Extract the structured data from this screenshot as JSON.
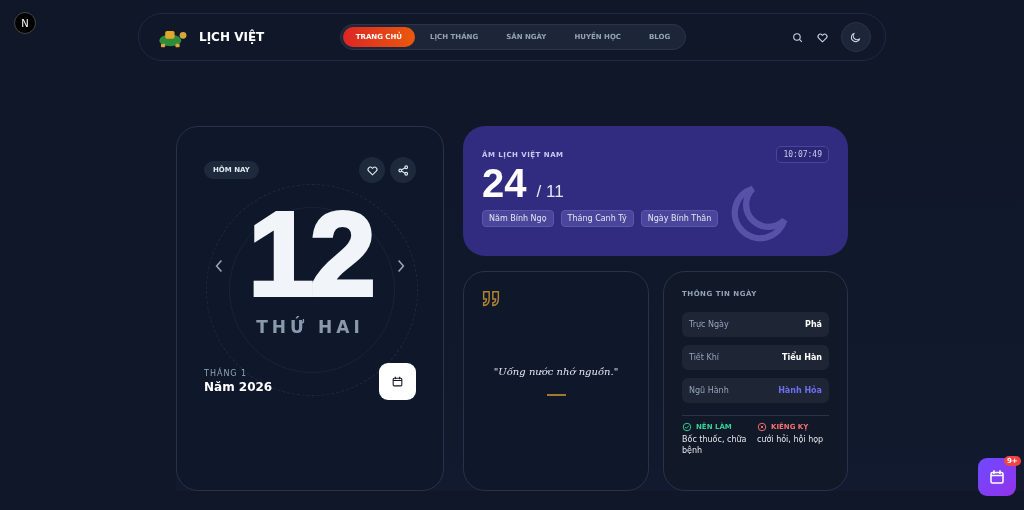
{
  "dev_badge": {
    "label": "N"
  },
  "header": {
    "brand": "LỊCH VIỆT",
    "nav": [
      {
        "label": "TRANG CHỦ",
        "selected": true
      },
      {
        "label": "LỊCH THÁNG",
        "selected": false
      },
      {
        "label": "SĂN NGÀY",
        "selected": false
      },
      {
        "label": "HUYỀN HỌC",
        "selected": false
      },
      {
        "label": "BLOG",
        "selected": false
      }
    ]
  },
  "today_card": {
    "badge": "HÔM NAY",
    "day": "12",
    "weekday": "THỨ HAI",
    "month": "THÁNG 1",
    "year": "Năm 2026"
  },
  "lunar_card": {
    "title": "ÂM LỊCH VIỆT NAM",
    "clock": "10:07:49",
    "day": "24",
    "month": "/ 11",
    "tags": [
      "Năm Bính Ngọ",
      "Tháng Canh Tý",
      "Ngày Bính Thân"
    ]
  },
  "quote_card": {
    "quote": "\"Uống nước nhớ nguồn.\""
  },
  "info_card": {
    "title": "THÔNG TIN NGÀY",
    "rows": [
      {
        "label": "Trực Ngày",
        "value": "Phá",
        "color": "#ffffff"
      },
      {
        "label": "Tiết Khí",
        "value": "Tiểu Hàn",
        "color": "#ffffff"
      },
      {
        "label": "Ngũ Hành",
        "value": "Hành Hỏa",
        "color": "#6d6ff0"
      }
    ],
    "good": {
      "title": "NÊN LÀM",
      "text": "Bốc thuốc, chữa bệnh"
    },
    "bad": {
      "title": "KIÊNG KỴ",
      "text": "cưới hỏi, hội họp"
    }
  },
  "fab": {
    "badge": "9+"
  }
}
